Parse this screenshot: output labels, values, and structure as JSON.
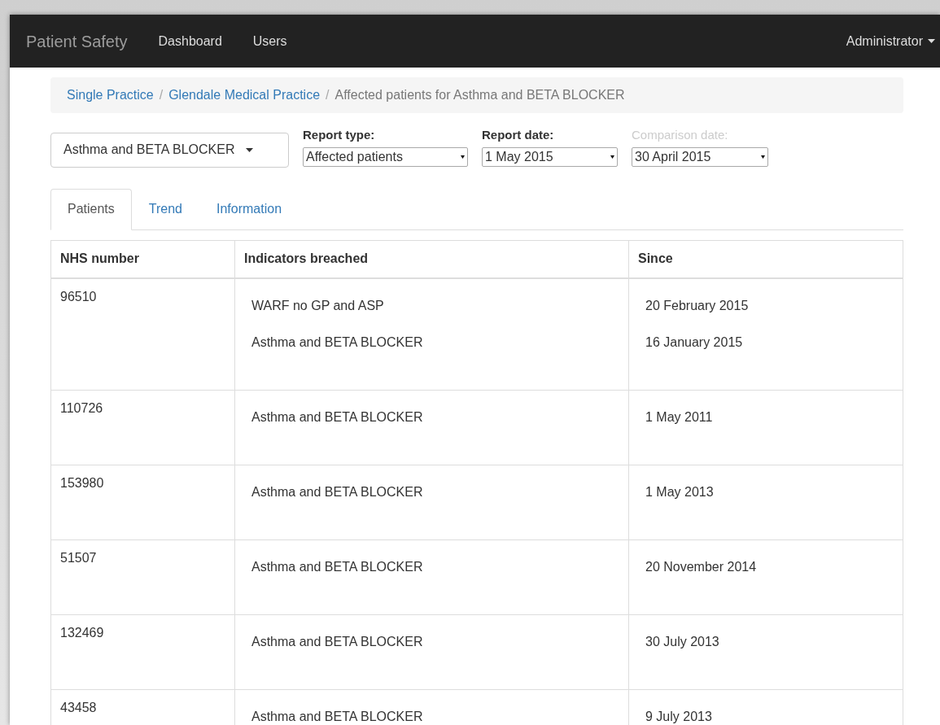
{
  "navbar": {
    "brand": "Patient Safety",
    "links": [
      "Dashboard",
      "Users"
    ],
    "user_menu": "Administrator"
  },
  "breadcrumb": {
    "links": [
      "Single Practice",
      "Glendale Medical Practice"
    ],
    "separators": [
      "/",
      "/"
    ],
    "current": "Affected patients for Asthma and BETA BLOCKER"
  },
  "indicator_dropdown": "Asthma and BETA BLOCKER",
  "filters": [
    {
      "label": "Report type:",
      "value": "Affected patients",
      "disabled": false
    },
    {
      "label": "Report date:",
      "value": "1 May 2015",
      "disabled": false
    },
    {
      "label": "Comparison date:",
      "value": "30 April 2015",
      "disabled": true
    }
  ],
  "tabs": [
    {
      "label": "Patients",
      "selected": true
    },
    {
      "label": "Trend",
      "selected": false
    },
    {
      "label": "Information",
      "selected": false
    }
  ],
  "table": {
    "columns": [
      "NHS number",
      "Indicators breached",
      "Since"
    ],
    "rows": [
      {
        "nhs_number": "96510",
        "indicators": [
          {
            "name": "WARF no GP and ASP",
            "since": "20 February 2015"
          },
          {
            "name": "Asthma and BETA BLOCKER",
            "since": "16 January 2015"
          }
        ]
      },
      {
        "nhs_number": "110726",
        "indicators": [
          {
            "name": "Asthma and BETA BLOCKER",
            "since": "1 May 2011"
          }
        ]
      },
      {
        "nhs_number": "153980",
        "indicators": [
          {
            "name": "Asthma and BETA BLOCKER",
            "since": "1 May 2013"
          }
        ]
      },
      {
        "nhs_number": "51507",
        "indicators": [
          {
            "name": "Asthma and BETA BLOCKER",
            "since": "20 November 2014"
          }
        ]
      },
      {
        "nhs_number": "132469",
        "indicators": [
          {
            "name": "Asthma and BETA BLOCKER",
            "since": "30 July 2013"
          }
        ]
      },
      {
        "nhs_number": "43458",
        "indicators": [
          {
            "name": "Asthma and BETA BLOCKER",
            "since": "9 July 2013"
          }
        ]
      }
    ]
  }
}
